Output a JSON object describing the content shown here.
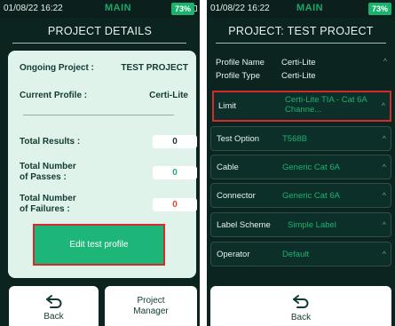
{
  "left": {
    "status": {
      "time": "01/08/22 16:22",
      "mode": "MAIN",
      "battery": "73%"
    },
    "title": "PROJECT DETAILS",
    "ongoing_label": "Ongoing Project :",
    "ongoing_value": "TEST PROJECT",
    "profile_label": "Current Profile :",
    "profile_value": "Certi-Lite",
    "total_results_label": "Total Results :",
    "total_results_value": "0",
    "passes_label_1": "Total Number",
    "passes_label_2": "of Passes :",
    "passes_value": "0",
    "failures_label_1": "Total Number",
    "failures_label_2": "of Failures :",
    "failures_value": "0",
    "edit_button": "Edit test profile",
    "back_label": "Back",
    "pm_label_1": "Project",
    "pm_label_2": "Manager",
    "colors": {
      "pass": "#19b36e",
      "fail": "#e8412f",
      "neutral": "#123a32"
    }
  },
  "right": {
    "status": {
      "time": "01/08/22 16:22",
      "mode": "MAIN",
      "battery": "73%"
    },
    "title": "PROJECT: TEST PROJECT",
    "profile_name_label": "Profile Name",
    "profile_name_value": "Certi-Lite",
    "profile_type_label": "Profile Type",
    "profile_type_value": "Certi-Lite",
    "limit_label": "Limit",
    "limit_value_1": "Certi-Lite TIA - Cat 6A",
    "limit_value_2": "Channe...",
    "rows": [
      {
        "label": "Test Option",
        "value": "T568B"
      },
      {
        "label": "Cable",
        "value": "Generic Cat 6A"
      },
      {
        "label": "Connector",
        "value": "Generic Cat 6A"
      },
      {
        "label": "Label Scheme",
        "value": "Simple Label"
      },
      {
        "label": "Operator",
        "value": "Default"
      }
    ],
    "back_label": "Back"
  }
}
